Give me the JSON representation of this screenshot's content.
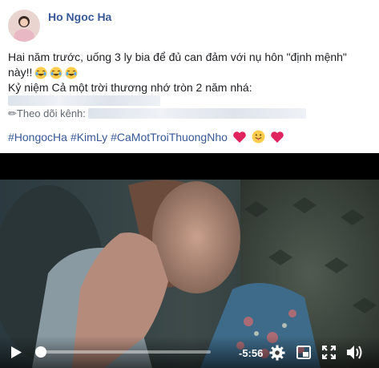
{
  "post": {
    "author_name": "Ho Ngoc Ha",
    "text_line1": "Hai năm trước, uống 3 ly bia để đủ can đảm với nụ hôn \"định mệnh\"",
    "text_line2": "này!!",
    "text_line3": "Kỷ niệm Cả một trời thương nhớ tròn 2 năm nhá:",
    "text_line5_prefix": "✏Theo dõi kênh:",
    "hashtags": [
      "#HongocHa",
      "#KimLy",
      "#CaMotTroiThuongNho"
    ]
  },
  "video": {
    "remaining_time": "-5:56",
    "progress": 0.0
  },
  "icons": {
    "laugh_emoji": "tears-of-joy-emoji",
    "heart": "red-heart-emoji",
    "tongue_emoji": "tongue-out-emoji"
  },
  "colors": {
    "link": "#385898",
    "heart": "#e0245e",
    "text": "#1c1e21"
  }
}
